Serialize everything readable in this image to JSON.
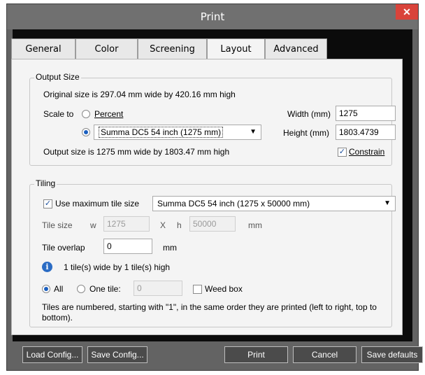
{
  "window": {
    "title": "Print",
    "close_glyph": "✕"
  },
  "tabs": [
    {
      "label": "General"
    },
    {
      "label": "Color"
    },
    {
      "label": "Screening"
    },
    {
      "label": "Layout"
    },
    {
      "label": "Advanced"
    }
  ],
  "active_tab": "Layout",
  "output_size": {
    "legend": "Output Size",
    "original_text": "Original size is 297.04 mm wide by 420.16 mm high",
    "scale_to_label": "Scale to",
    "percent_label": "Percent",
    "device_value": "Summa DC5 54 inch (1275 mm)",
    "width_label": "Width (mm)",
    "width_value": "1275",
    "height_label": "Height (mm)",
    "height_value": "1803.4739",
    "output_text": "Output size is 1275 mm wide by 1803.47 mm high",
    "constrain_label": "Constrain",
    "constrain_checked": true
  },
  "tiling": {
    "legend": "Tiling",
    "use_max_label": "Use maximum tile size",
    "use_max_checked": true,
    "tile_size_select": "Summa DC5 54 inch (1275 x 50000 mm)",
    "tile_size_label": "Tile size",
    "w_label": "w",
    "w_value": "1275",
    "x_label": "X",
    "h_label": "h",
    "h_value": "50000",
    "mm_unit": "mm",
    "overlap_label": "Tile overlap",
    "overlap_value": "0",
    "overlap_unit": "mm",
    "info_text": "1 tile(s) wide by 1 tile(s) high",
    "all_label": "All",
    "one_tile_label": "One tile:",
    "one_tile_value": "0",
    "weed_box_label": "Weed box",
    "note_line1": "Tiles are numbered, starting with \"1\", in the same order they are printed (left to right, top to",
    "note_line2": "bottom)."
  },
  "footer": {
    "load_config": "Load Config...",
    "save_config": "Save Config...",
    "print": "Print",
    "cancel": "Cancel",
    "save_defaults": "Save defaults"
  }
}
